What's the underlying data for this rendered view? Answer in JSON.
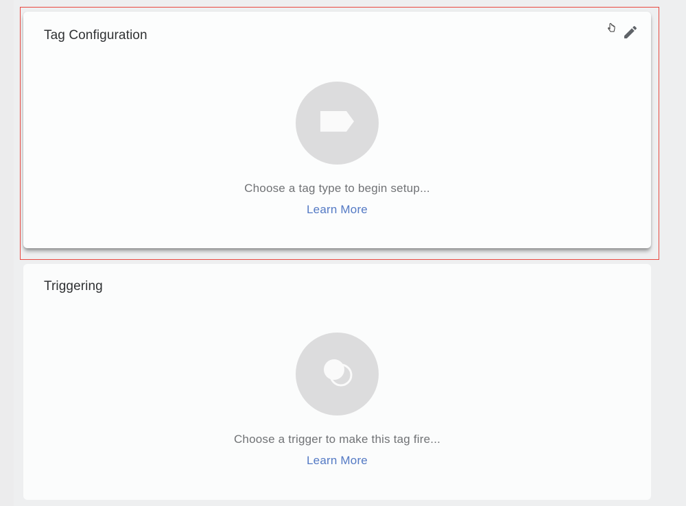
{
  "tag_configuration": {
    "title": "Tag Configuration",
    "hint": "Choose a tag type to begin setup...",
    "learn_more": "Learn More",
    "edit_icon": "pencil-icon",
    "placeholder_icon": "tag-icon"
  },
  "triggering": {
    "title": "Triggering",
    "hint": "Choose a trigger to make this tag fire...",
    "learn_more": "Learn More",
    "placeholder_icon": "trigger-circles-icon"
  },
  "colors": {
    "highlight_border": "#e8473f",
    "link": "#5379c4",
    "icon_circle": "#dcdcdd",
    "title_text": "#2f3133",
    "hint_text": "#707275"
  }
}
